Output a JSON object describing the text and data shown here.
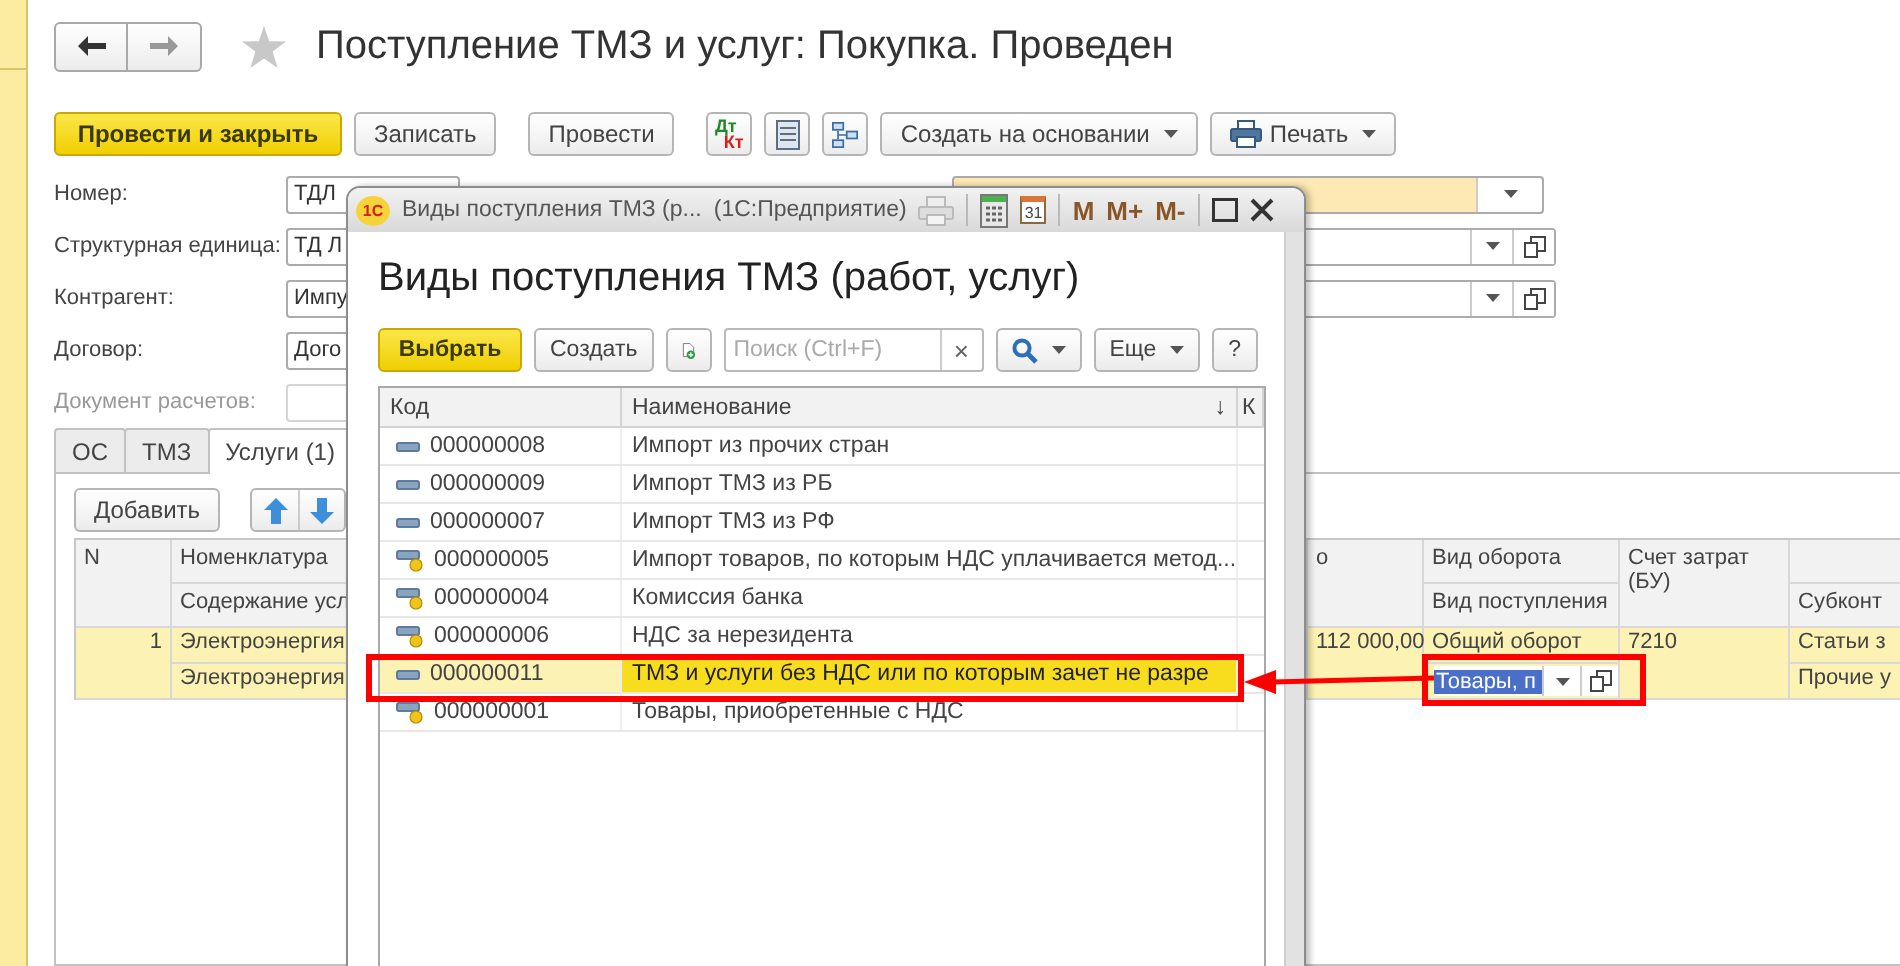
{
  "window": {
    "title": "Поступление ТМЗ и услуг: Покупка. Проведен"
  },
  "toolbar": [
    {
      "kind": "primary",
      "label": "Провести и закрыть"
    },
    {
      "kind": "text",
      "label": "Записать"
    },
    {
      "kind": "text",
      "label": "Провести"
    },
    {
      "kind": "dtkt",
      "top": "Дт",
      "bottom": "Кт"
    },
    {
      "kind": "list"
    },
    {
      "kind": "structure"
    },
    {
      "kind": "menu",
      "label": "Создать на основании"
    },
    {
      "kind": "print",
      "label": "Печать"
    }
  ],
  "form": [
    {
      "kind": "number",
      "label": "Номер:",
      "value": "ТДЛ"
    },
    {
      "kind": "choice",
      "label": "Структурная единица:",
      "value": "ТД Л"
    },
    {
      "kind": "choice",
      "label": "Контрагент:",
      "value": "Импу"
    },
    {
      "kind": "short",
      "label": "Договор:",
      "value": "Дого"
    },
    {
      "kind": "short",
      "label": "Документ расчетов:",
      "disabled": true
    }
  ],
  "tabs": [
    {
      "label": "ОС",
      "selected": false
    },
    {
      "label": "ТМЗ",
      "selected": false
    },
    {
      "label": "Услуги (1)",
      "selected": true
    }
  ],
  "add_button": "Добавить",
  "table": {
    "header": {
      "n": "N",
      "item": "Номенклатура",
      "content": "Содержание усл",
      "amount": "о",
      "turnover": "Вид оборота",
      "receipt": "Вид поступления",
      "account": "Счет затрат (БУ)",
      "subconto": "Субконт"
    },
    "rows": [
      {
        "n": "1",
        "item": "Электроэнергия",
        "content": "Электроэнергия",
        "amount": "112 000,00",
        "turnover": "Общий оборот",
        "receipt": "Товары, п",
        "account": "7210",
        "subconto1": "Статьи з",
        "subconto2": "Прочие у",
        "selected": true
      }
    ]
  },
  "dialog": {
    "badge": "1С",
    "caption": "Виды поступления ТМЗ (р...",
    "app": "(1С:Предприятие)",
    "calendar_day": "31",
    "memory_buttons": [
      "M",
      "M+",
      "M-"
    ],
    "title": "Виды поступления ТМЗ (работ, услуг)",
    "toolbar": [
      {
        "kind": "primary",
        "label": "Выбрать"
      },
      {
        "kind": "text",
        "label": "Создать"
      },
      {
        "kind": "add"
      },
      {
        "kind": "search-field",
        "placeholder": "Поиск (Ctrl+F)",
        "clear": "×"
      },
      {
        "kind": "search"
      },
      {
        "kind": "menu",
        "label": "Еще"
      },
      {
        "kind": "text",
        "label": "?"
      }
    ],
    "columns": [
      {
        "label": "Код"
      },
      {
        "label": "Наименование",
        "sort": "↓"
      },
      {
        "label": "К"
      }
    ],
    "rows": [
      {
        "kind": "plain",
        "code": "000000008",
        "name": "Импорт из прочих стран",
        "selected": false
      },
      {
        "kind": "plain",
        "code": "000000009",
        "name": "Импорт ТМЗ из РБ",
        "selected": false
      },
      {
        "kind": "plain",
        "code": "000000007",
        "name": "Импорт ТМЗ из РФ",
        "selected": false
      },
      {
        "kind": "marked",
        "code": "000000005",
        "name": "Импорт товаров, по которым НДС уплачивается метод...",
        "selected": false
      },
      {
        "kind": "marked",
        "code": "000000004",
        "name": "Комиссия банка",
        "selected": false
      },
      {
        "kind": "marked",
        "code": "000000006",
        "name": "НДС за нерезидента",
        "selected": false
      },
      {
        "kind": "plain",
        "code": "000000011",
        "name": "ТМЗ и услуги без НДС или по которым зачет не разре",
        "selected": true
      },
      {
        "kind": "marked",
        "code": "000000001",
        "name": "Товары, приобретенные с НДС",
        "selected": false
      }
    ]
  }
}
